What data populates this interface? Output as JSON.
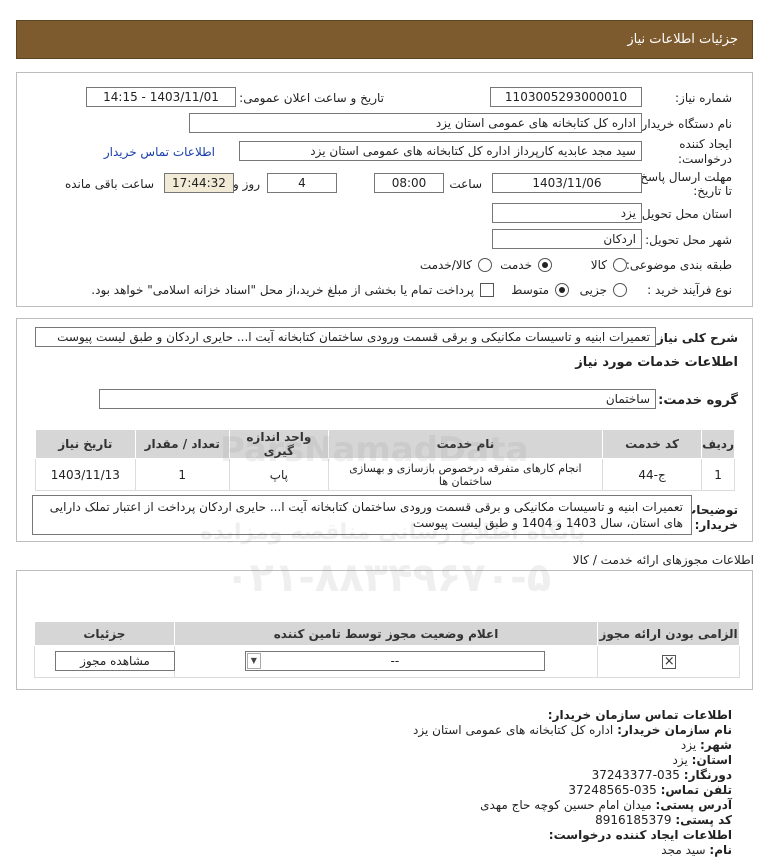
{
  "header": {
    "title": "جزئیات اطلاعات نیاز"
  },
  "form": {
    "need_number_label": "شماره نیاز:",
    "need_number": "1103005293000010",
    "announce_label": "تاریخ و ساعت اعلان عمومی:",
    "announce_value": "1403/11/01 - 14:15",
    "buyer_label": "نام دستگاه خریدار:",
    "buyer_value": "اداره کل کتابخانه های عمومی استان یزد",
    "creator_label_1": "ایجاد کننده",
    "creator_label_2": "درخواست:",
    "creator_value": "سید مجد عابدیه کارپرداز اداره کل کتابخانه های عمومی استان یزد",
    "contact_link": "اطلاعات تماس خریدار",
    "deadline_label_1": "مهلت ارسال پاسخ:",
    "deadline_label_2": "تا تاریخ:",
    "deadline_date": "1403/11/06",
    "time_label": "ساعت",
    "deadline_time": "08:00",
    "days_value": "4",
    "days_label": "روز و",
    "remaining_time": "17:44:32",
    "remaining_label": "ساعت باقی مانده",
    "province_label": "استان محل تحویل:",
    "province_value": "یزد",
    "city_label": "شهر محل تحویل:",
    "city_value": "اردکان",
    "category_label": "طبقه بندی موضوعی:",
    "category_options": [
      "کالا",
      "خدمت",
      "کالا/خدمت"
    ],
    "category_selected": "خدمت",
    "process_label": "نوع فرآیند خرید :",
    "process_options": [
      "جزیی",
      "متوسط"
    ],
    "process_selected": "متوسط",
    "payment_note": "پرداخت تمام یا بخشی از مبلغ خرید،از محل \"اسناد خزانه اسلامی\" خواهد بود."
  },
  "summary": {
    "label": "شرح کلی نیاز:",
    "value": "تعمیرات ابنیه و تاسیسات مکانیکی و برقی قسمت ورودی ساختمان کتابخانه آیت ا... حایری اردکان و طبق لیست پیوست"
  },
  "services": {
    "title": "اطلاعات خدمات مورد نیاز",
    "group_label": "گروه خدمت:",
    "group_value": "ساختمان",
    "columns": [
      "ردیف",
      "کد خدمت",
      "نام خدمت",
      "واحد اندازه گیری",
      "تعداد / مقدار",
      "تاریخ نیاز"
    ],
    "rows": [
      {
        "row": "1",
        "code": "ج-44",
        "name": "انجام کارهای متفرقه درخصوص بازسازی و بهسازی ساختمان ها",
        "unit": "پاپ",
        "qty": "1",
        "date": "1403/11/13"
      }
    ]
  },
  "buyer_notes": {
    "label_1": "توضیحات",
    "label_2": "خریدار:",
    "value": "تعمیرات ابنیه و تاسیسات مکانیکی و برقی قسمت ورودی ساختمان کتابخانه آیت ا... حایری اردکان پرداخت از اعتبار تملک دارایی های استان، سال 1403 و 1404 و طبق لیست پیوست"
  },
  "licenses": {
    "title": "اطلاعات مجوزهای ارائه خدمت / کالا",
    "columns": [
      "الزامی بودن ارائه مجوز",
      "اعلام وضعیت مجوز توسط تامین کننده",
      "جزئیات"
    ],
    "select_value": "--",
    "view_button": "مشاهده مجوز"
  },
  "contact": {
    "title": "اطلاعات تماس سازمان خریدار:",
    "org_label": "نام سازمان خریدار:",
    "org_value": "اداره کل کتابخانه های عمومی استان یزد",
    "city_label": "شهر:",
    "city_value": "یزد",
    "province_label": "استان:",
    "province_value": "یزد",
    "fax_label": "دورنگار:",
    "fax_value": "035-37243377",
    "phone_label": "تلفن تماس:",
    "phone_value": "035-37248565",
    "address_label": "آدرس پستی:",
    "address_value": "میدان امام حسین کوچه حاج مهدی",
    "postal_label": "کد پستی:",
    "postal_value": "8916185379",
    "creator_title": "اطلاعات ایجاد کننده درخواست:",
    "name_label": "نام:",
    "name_value": "سید مجد"
  },
  "watermark": {
    "brand": "ParsNamadData",
    "line1": "پایگاه اطلاع رسانی مناقصه ومزایده",
    "phone": "۰۲۱-۸۸۳۴۹۶۷۰-۵"
  }
}
